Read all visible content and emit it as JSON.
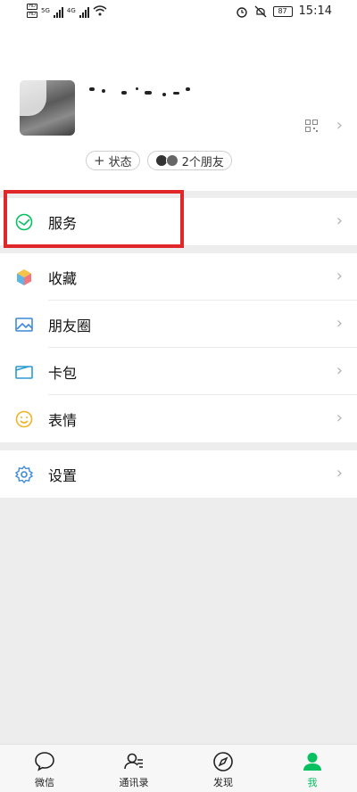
{
  "status_bar": {
    "sim1": "HD",
    "sim2": "HD",
    "net1": "5G",
    "net2": "4G",
    "battery": "87",
    "time": "15:14"
  },
  "profile": {
    "status_chip": "状态",
    "friends_chip": "2个朋友"
  },
  "menu": {
    "service": "服务",
    "favorites": "收藏",
    "moments": "朋友圈",
    "cards": "卡包",
    "stickers": "表情",
    "settings": "设置"
  },
  "tabbar": [
    {
      "label": "微信"
    },
    {
      "label": "通讯录"
    },
    {
      "label": "发现"
    },
    {
      "label": "我"
    }
  ],
  "colors": {
    "accent": "#07c160",
    "highlight": "#e0282b"
  }
}
